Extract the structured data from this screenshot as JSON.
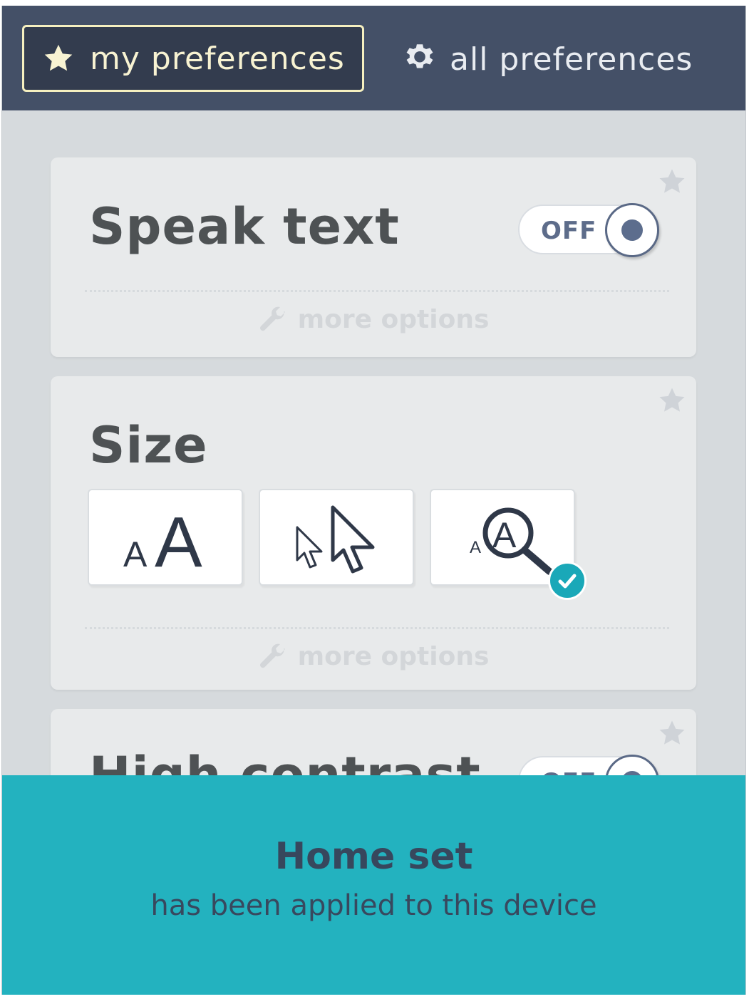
{
  "tabs": {
    "my_preferences": "my preferences",
    "all_preferences": "all preferences"
  },
  "cards": {
    "speak_text": {
      "title": "Speak text",
      "toggle_state": "OFF",
      "more_options": "more options"
    },
    "size": {
      "title": "Size",
      "more_options": "more options",
      "options": [
        "text-size",
        "cursor-size",
        "magnifier"
      ],
      "selected": "magnifier"
    },
    "high_contrast": {
      "title": "High contrast",
      "toggle_state": "OFF"
    }
  },
  "notification": {
    "title": "Home set",
    "message": "has been applied to this device"
  },
  "colors": {
    "topbar": "#445067",
    "accent": "#23b2bf",
    "panel": "#d6dadd",
    "card": "#e8eaeb"
  }
}
